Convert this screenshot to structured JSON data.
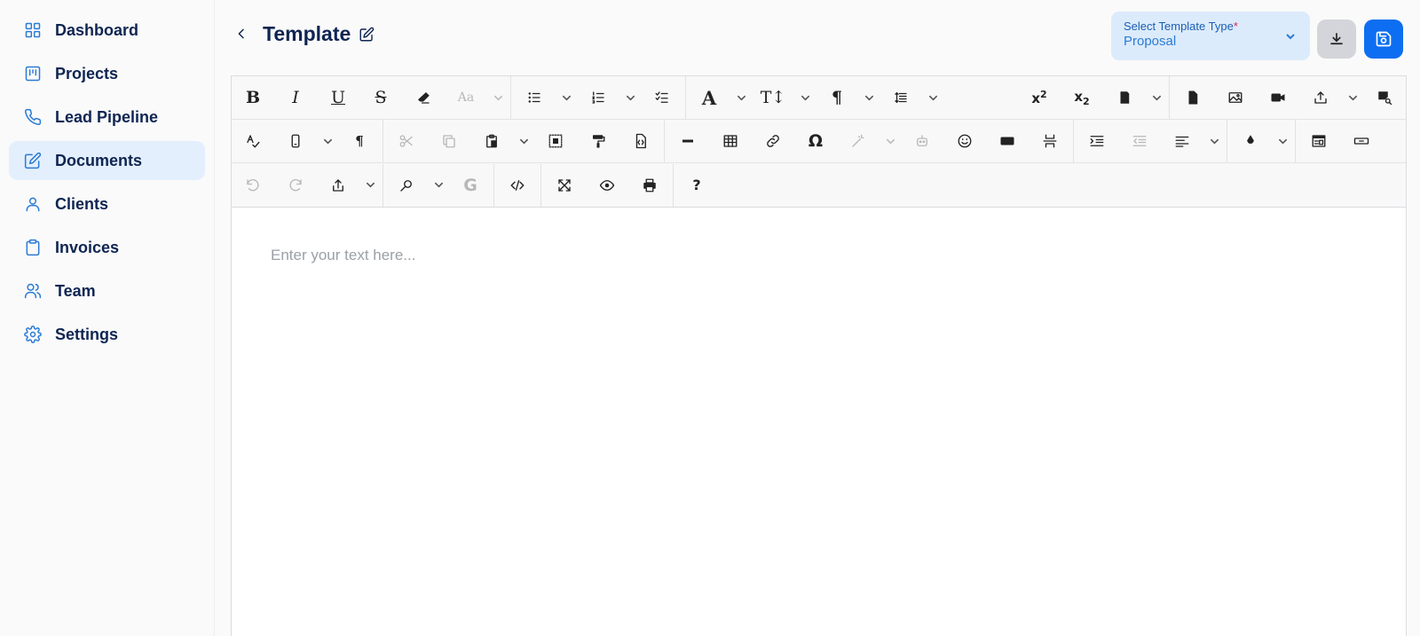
{
  "sidebar": {
    "items": [
      {
        "label": "Dashboard",
        "icon": "dashboard-icon",
        "active": false
      },
      {
        "label": "Projects",
        "icon": "projects-icon",
        "active": false
      },
      {
        "label": "Lead Pipeline",
        "icon": "phone-icon",
        "active": false
      },
      {
        "label": "Documents",
        "icon": "edit-document-icon",
        "active": true
      },
      {
        "label": "Clients",
        "icon": "user-icon",
        "active": false
      },
      {
        "label": "Invoices",
        "icon": "clipboard-icon",
        "active": false
      },
      {
        "label": "Team",
        "icon": "team-icon",
        "active": false
      },
      {
        "label": "Settings",
        "icon": "gear-icon",
        "active": false
      }
    ]
  },
  "header": {
    "title": "Template",
    "template_type": {
      "label": "Select Template Type",
      "required_mark": "*",
      "value": "Proposal"
    }
  },
  "editor": {
    "placeholder": "Enter your text here..."
  },
  "colors": {
    "accent": "#0d6ef1",
    "active_bg": "#e3effc",
    "select_bg": "#dcebfb",
    "nav_text": "#0f2552"
  }
}
